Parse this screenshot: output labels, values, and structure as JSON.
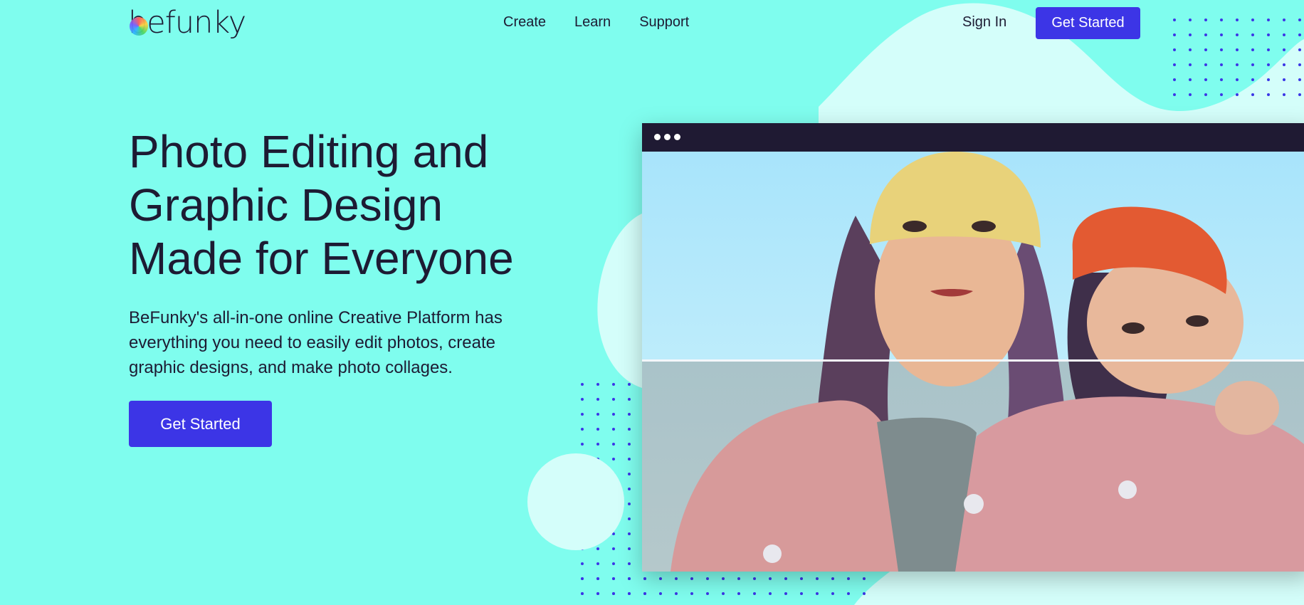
{
  "brand": {
    "logo_text": "befunky"
  },
  "nav": {
    "items": [
      {
        "label": "Create"
      },
      {
        "label": "Learn"
      },
      {
        "label": "Support"
      }
    ]
  },
  "header": {
    "sign_in": "Sign In",
    "cta": "Get Started"
  },
  "hero": {
    "headline_lines": [
      "Photo Editing and",
      "Graphic Design",
      "Made for Everyone"
    ],
    "description": "BeFunky's all-in-one online Creative Platform has everything you need to easily edit photos, create graphic designs, and make photo collages.",
    "cta": "Get Started"
  },
  "colors": {
    "background": "#7ffdee",
    "accent": "#3c35e6",
    "text": "#1d1b33",
    "window_bar": "#1f1a33"
  },
  "icons": [
    "befunky-logo-icon",
    "window-menu-dots-icon"
  ]
}
